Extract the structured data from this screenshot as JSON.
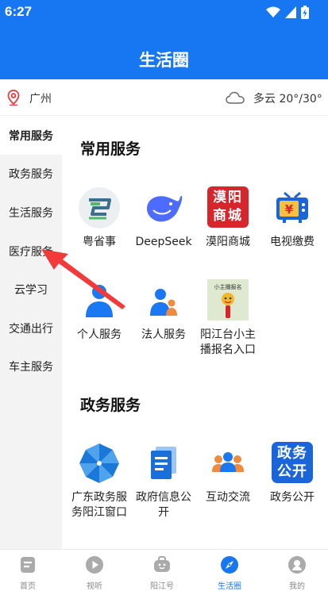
{
  "status": {
    "time": "6:27"
  },
  "header": {
    "title": "生活圈"
  },
  "location": {
    "city": "广州",
    "weather": "多云 20°/30°"
  },
  "sidebar": {
    "items": [
      {
        "label": "常用服务",
        "active": true
      },
      {
        "label": "政务服务"
      },
      {
        "label": "生活服务"
      },
      {
        "label": "医疗服务"
      },
      {
        "label": "云学习"
      },
      {
        "label": "交通出行"
      },
      {
        "label": "车主服务"
      }
    ]
  },
  "sections": {
    "common": {
      "title": "常用服务",
      "items": [
        {
          "label": "粤省事",
          "icon": "yueshengshi-icon"
        },
        {
          "label": "DeepSeek",
          "icon": "deepseek-whale-icon"
        },
        {
          "label": "漠阳商城",
          "icon": "moyang-mall-icon",
          "icon_text": "漠阳商城"
        },
        {
          "label": "电视缴费",
          "icon": "tv-payment-icon"
        },
        {
          "label": "个人服务",
          "icon": "person-icon"
        },
        {
          "label": "法人服务",
          "icon": "legal-person-icon"
        },
        {
          "label": "阳江台小主播报名入口",
          "icon": "anchor-signup-icon",
          "icon_text": "小主播报名"
        }
      ]
    },
    "government": {
      "title": "政务服务",
      "items": [
        {
          "label": "广东政务服务阳江窗口",
          "icon": "pinwheel-icon"
        },
        {
          "label": "政府信息公开",
          "icon": "document-icon"
        },
        {
          "label": "互动交流",
          "icon": "people-group-icon"
        },
        {
          "label": "政务公开",
          "icon": "zhengwu-gongkai-icon",
          "icon_text": "政务公开"
        }
      ]
    }
  },
  "bottom_nav": [
    {
      "label": "首页",
      "icon": "home-icon"
    },
    {
      "label": "视听",
      "icon": "play-icon"
    },
    {
      "label": "阳江号",
      "icon": "briefcase-icon"
    },
    {
      "label": "生活圈",
      "icon": "compass-icon",
      "active": true
    },
    {
      "label": "我的",
      "icon": "profile-icon"
    }
  ],
  "colors": {
    "primary": "#1777f2",
    "annotation_arrow": "#f23a3a"
  }
}
